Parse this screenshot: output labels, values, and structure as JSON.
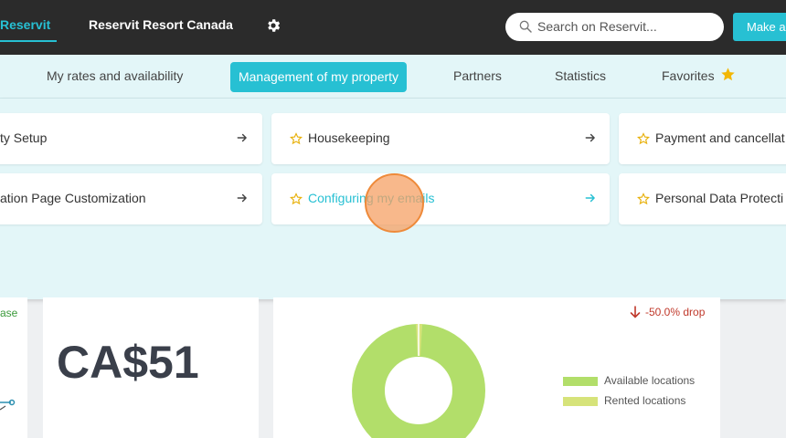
{
  "topbar": {
    "tab_active": "Reservit",
    "tab_property": "Reservit Resort Canada",
    "search_placeholder": "Search on Reservit...",
    "cta_label": "Make a"
  },
  "nav": {
    "items": [
      "My rates and availability",
      "Management of my property",
      "Partners",
      "Statistics",
      "Favorites"
    ],
    "active_index": 1
  },
  "menu": {
    "cards": [
      {
        "label": "ty Setup",
        "starred": false
      },
      {
        "label": "Housekeeping",
        "starred": true
      },
      {
        "label": "Payment and cancellat",
        "starred": true
      },
      {
        "label": "ation Page Customization",
        "starred": false
      },
      {
        "label": "Configuring my emails",
        "starred": true,
        "highlighted": true
      },
      {
        "label": "Personal Data Protecti",
        "starred": true
      }
    ]
  },
  "dashboard": {
    "left_fragment": "ase",
    "price": "CA$51",
    "change": "-50.0% drop",
    "legend": [
      "Available locations",
      "Rented locations"
    ]
  },
  "colors": {
    "accent": "#27c0d3",
    "topbar": "#2b2b2b",
    "panel": "#e3f6f8",
    "star": "#f2b705",
    "donut_available": "#b2de6a",
    "donut_rented": "#d6e37a",
    "drop": "#c0392b"
  }
}
